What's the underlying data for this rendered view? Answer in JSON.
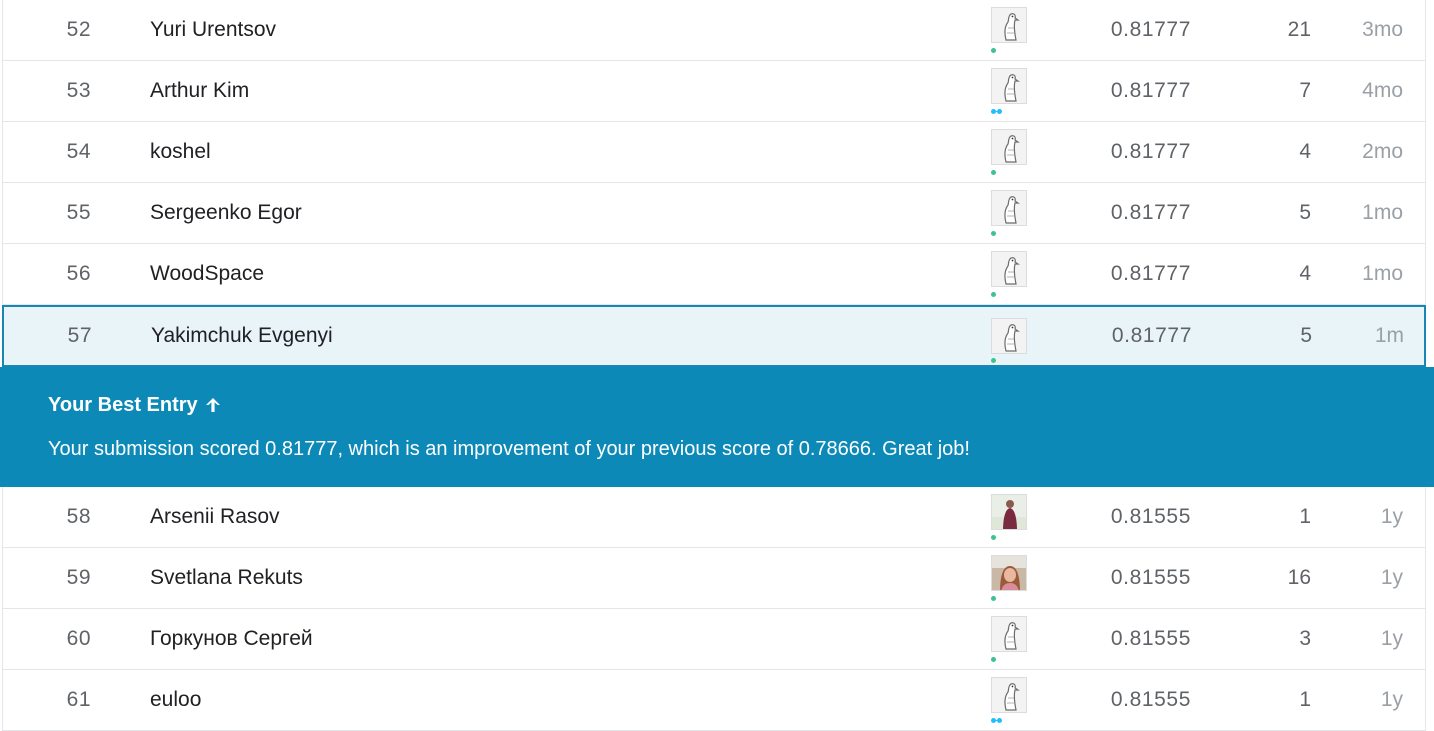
{
  "rows_before": [
    {
      "rank": "52",
      "name": "Yuri Urentsov",
      "score": "0.81777",
      "entries": "21",
      "last": "3mo",
      "avatar": "default-goose-avatar",
      "badge": "single-dot"
    },
    {
      "rank": "53",
      "name": "Arthur Kim",
      "score": "0.81777",
      "entries": "7",
      "last": "4mo",
      "avatar": "default-goose-avatar",
      "badge": "double-dot"
    },
    {
      "rank": "54",
      "name": "koshel",
      "score": "0.81777",
      "entries": "4",
      "last": "2mo",
      "avatar": "default-goose-avatar",
      "badge": "single-dot"
    },
    {
      "rank": "55",
      "name": "Sergeenko Egor",
      "score": "0.81777",
      "entries": "5",
      "last": "1mo",
      "avatar": "default-goose-avatar",
      "badge": "single-dot"
    },
    {
      "rank": "56",
      "name": "WoodSpace",
      "score": "0.81777",
      "entries": "4",
      "last": "1mo",
      "avatar": "default-goose-avatar",
      "badge": "single-dot"
    }
  ],
  "my_row": {
    "rank": "57",
    "name": "Yakimchuk Evgenyi",
    "score": "0.81777",
    "entries": "5",
    "last": "1m",
    "avatar": "default-goose-avatar",
    "badge": "single-dot"
  },
  "banner": {
    "title": "Your Best Entry",
    "icon": "arrow-up-icon",
    "message": "Your submission scored 0.81777, which is an improvement of your previous score of 0.78666. Great job!"
  },
  "rows_after": [
    {
      "rank": "58",
      "name": "Arsenii Rasov",
      "score": "0.81555",
      "entries": "1",
      "last": "1y",
      "avatar": "photo-avatar-person-maroon",
      "badge": "single-dot"
    },
    {
      "rank": "59",
      "name": "Svetlana Rekuts",
      "score": "0.81555",
      "entries": "16",
      "last": "1y",
      "avatar": "photo-avatar-woman",
      "badge": "single-dot"
    },
    {
      "rank": "60",
      "name": "Горкунов Сергей",
      "score": "0.81555",
      "entries": "3",
      "last": "1y",
      "avatar": "default-goose-avatar",
      "badge": "single-dot"
    },
    {
      "rank": "61",
      "name": "euloo",
      "score": "0.81555",
      "entries": "1",
      "last": "1y",
      "avatar": "default-goose-avatar",
      "badge": "double-dot"
    }
  ],
  "colors": {
    "accent": "#0d89b8",
    "highlight_row_bg": "#e8f4f8",
    "highlight_border": "#1a86b3",
    "tier_dot_blue": "#20beff",
    "tier_dot_green": "#3ec28f"
  }
}
